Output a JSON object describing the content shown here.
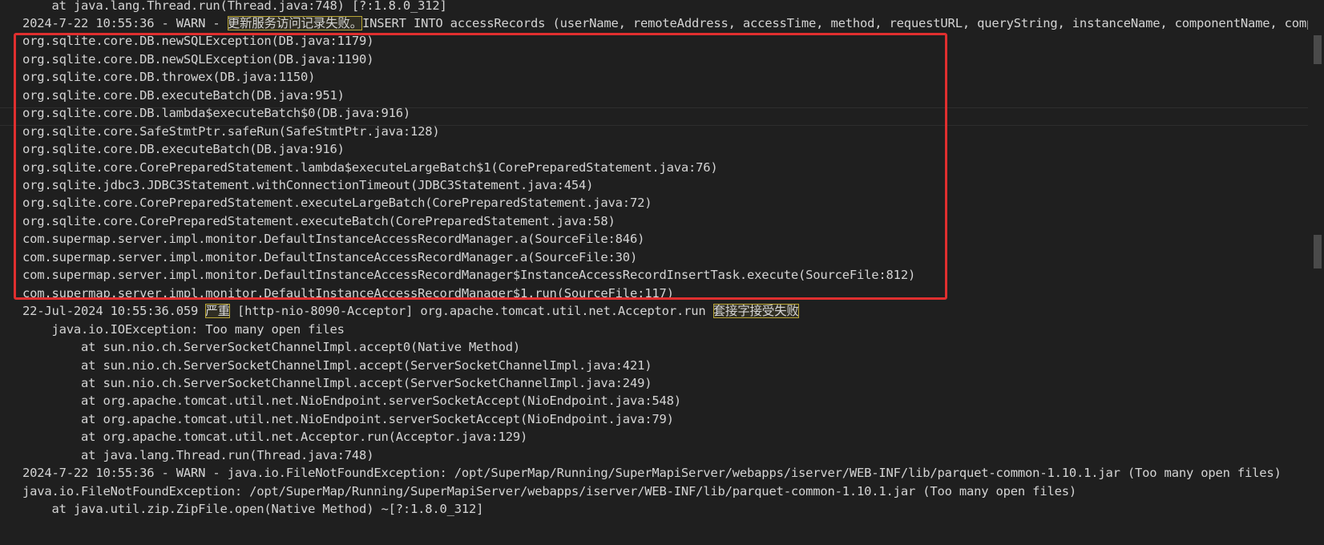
{
  "log_lines": [
    {
      "segments": [
        {
          "text": "    at java.lang.Thread.run(Thread.java:748) [?:1.8.0_312]"
        }
      ]
    },
    {
      "segments": [
        {
          "text": "2024-7-22 10:55:36 - WARN - "
        },
        {
          "text": "更新服务访问记录失败。",
          "hl": true
        },
        {
          "text": "INSERT INTO accessRecords (userName, remoteAddress, accessTime, method, requestURL, queryString, instanceName, componentName, componentType, interfaceName, interfaceType, providerNames, providerType"
        }
      ]
    },
    {
      "segments": [
        {
          "text": "org.sqlite.core.DB.newSQLException(DB.java:1179)"
        }
      ]
    },
    {
      "segments": [
        {
          "text": "org.sqlite.core.DB.newSQLException(DB.java:1190)"
        }
      ]
    },
    {
      "segments": [
        {
          "text": "org.sqlite.core.DB.throwex(DB.java:1150)"
        }
      ]
    },
    {
      "segments": [
        {
          "text": "org.sqlite.core.DB.executeBatch(DB.java:951)"
        }
      ]
    },
    {
      "segments": [
        {
          "text": "org.sqlite.core.DB.lambda$executeBatch$0(DB.java:916)"
        }
      ]
    },
    {
      "segments": [
        {
          "text": "org.sqlite.core.SafeStmtPtr.safeRun(SafeStmtPtr.java:128)"
        }
      ]
    },
    {
      "segments": [
        {
          "text": "org.sqlite.core.DB.executeBatch(DB.java:916)"
        }
      ]
    },
    {
      "segments": [
        {
          "text": "org.sqlite.core.CorePreparedStatement.lambda$executeLargeBatch$1(CorePreparedStatement.java:76)"
        }
      ]
    },
    {
      "segments": [
        {
          "text": "org.sqlite.jdbc3.JDBC3Statement.withConnectionTimeout(JDBC3Statement.java:454)"
        }
      ]
    },
    {
      "segments": [
        {
          "text": "org.sqlite.core.CorePreparedStatement.executeLargeBatch(CorePreparedStatement.java:72)"
        }
      ]
    },
    {
      "segments": [
        {
          "text": "org.sqlite.core.CorePreparedStatement.executeBatch(CorePreparedStatement.java:58)"
        }
      ]
    },
    {
      "segments": [
        {
          "text": "com.supermap.server.impl.monitor.DefaultInstanceAccessRecordManager.a(SourceFile:846)"
        }
      ]
    },
    {
      "segments": [
        {
          "text": "com.supermap.server.impl.monitor.DefaultInstanceAccessRecordManager.a(SourceFile:30)"
        }
      ]
    },
    {
      "segments": [
        {
          "text": "com.supermap.server.impl.monitor.DefaultInstanceAccessRecordManager$InstanceAccessRecordInsertTask.execute(SourceFile:812)"
        }
      ]
    },
    {
      "segments": [
        {
          "text": "com.supermap.server.impl.monitor.DefaultInstanceAccessRecordManager$1.run(SourceFile:117)"
        }
      ]
    },
    {
      "segments": [
        {
          "text": "22-Jul-2024 10:55:36.059 "
        },
        {
          "text": "严重",
          "hl": true
        },
        {
          "text": " [http-nio-8090-Acceptor] org.apache.tomcat.util.net.Acceptor.run "
        },
        {
          "text": "套接字接受失败",
          "hl": true
        }
      ]
    },
    {
      "segments": [
        {
          "text": "    java.io.IOException: Too many open files"
        }
      ]
    },
    {
      "segments": [
        {
          "text": "        at sun.nio.ch.ServerSocketChannelImpl.accept0(Native Method)"
        }
      ]
    },
    {
      "segments": [
        {
          "text": "        at sun.nio.ch.ServerSocketChannelImpl.accept(ServerSocketChannelImpl.java:421)"
        }
      ]
    },
    {
      "segments": [
        {
          "text": "        at sun.nio.ch.ServerSocketChannelImpl.accept(ServerSocketChannelImpl.java:249)"
        }
      ]
    },
    {
      "segments": [
        {
          "text": "        at org.apache.tomcat.util.net.NioEndpoint.serverSocketAccept(NioEndpoint.java:548)"
        }
      ]
    },
    {
      "segments": [
        {
          "text": "        at org.apache.tomcat.util.net.NioEndpoint.serverSocketAccept(NioEndpoint.java:79)"
        }
      ]
    },
    {
      "segments": [
        {
          "text": "        at org.apache.tomcat.util.net.Acceptor.run(Acceptor.java:129)"
        }
      ]
    },
    {
      "segments": [
        {
          "text": "        at java.lang.Thread.run(Thread.java:748)"
        }
      ]
    },
    {
      "segments": [
        {
          "text": "2024-7-22 10:55:36 - WARN - java.io.FileNotFoundException: /opt/SuperMap/Running/SuperMapiServer/webapps/iserver/WEB-INF/lib/parquet-common-1.10.1.jar (Too many open files)"
        }
      ]
    },
    {
      "segments": [
        {
          "text": "java.io.FileNotFoundException: /opt/SuperMap/Running/SuperMapiServer/webapps/iserver/WEB-INF/lib/parquet-common-1.10.1.jar (Too many open files)"
        }
      ]
    },
    {
      "segments": [
        {
          "text": "    at java.util.zip.ZipFile.open(Native Method) ~[?:1.8.0_312]"
        }
      ]
    }
  ],
  "colors": {
    "background": "#1f1f1f",
    "text": "#d4d4d4",
    "highlight_border": "#b8a535",
    "annotation_box": "#e02f2f"
  }
}
